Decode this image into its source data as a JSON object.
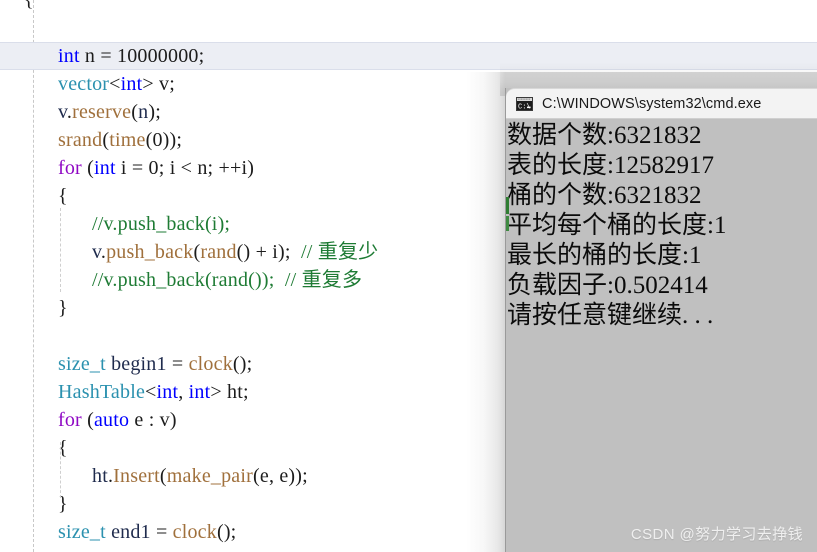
{
  "editor": {
    "name": "code-editor",
    "language": "C++",
    "lines": [
      {
        "indent": 0,
        "tokens": [
          {
            "t": "{",
            "c": "pun"
          }
        ],
        "partial_top": true
      },
      {
        "indent": 0,
        "tokens": [],
        "current": false
      },
      {
        "indent": 1,
        "current": true,
        "tokens": [
          {
            "t": "int",
            "c": "bkw"
          },
          {
            "t": " n = ",
            "c": "pun"
          },
          {
            "t": "10000000",
            "c": "num"
          },
          {
            "t": ";",
            "c": "pun"
          }
        ]
      },
      {
        "indent": 1,
        "tokens": [
          {
            "t": "vector",
            "c": "typ"
          },
          {
            "t": "<",
            "c": "pun"
          },
          {
            "t": "int",
            "c": "bkw"
          },
          {
            "t": "> v;",
            "c": "pun"
          }
        ]
      },
      {
        "indent": 1,
        "tokens": [
          {
            "t": "v",
            "c": "id"
          },
          {
            "t": ".",
            "c": "pun"
          },
          {
            "t": "reserve",
            "c": "fn"
          },
          {
            "t": "(",
            "c": "pun"
          },
          {
            "t": "n",
            "c": "id"
          },
          {
            "t": ");",
            "c": "pun"
          }
        ]
      },
      {
        "indent": 1,
        "tokens": [
          {
            "t": "srand",
            "c": "fn"
          },
          {
            "t": "(",
            "c": "pun"
          },
          {
            "t": "time",
            "c": "fn"
          },
          {
            "t": "(",
            "c": "pun"
          },
          {
            "t": "0",
            "c": "num"
          },
          {
            "t": "));",
            "c": "pun"
          }
        ]
      },
      {
        "indent": 1,
        "tokens": [
          {
            "t": "for",
            "c": "kw"
          },
          {
            "t": " (",
            "c": "pun"
          },
          {
            "t": "int",
            "c": "bkw"
          },
          {
            "t": " i = ",
            "c": "pun"
          },
          {
            "t": "0",
            "c": "num"
          },
          {
            "t": "; i < n; ++i)",
            "c": "pun"
          }
        ]
      },
      {
        "indent": 1,
        "tokens": [
          {
            "t": "{",
            "c": "pun"
          }
        ]
      },
      {
        "indent": 2,
        "tokens": [
          {
            "t": "//v.push_back(i);",
            "c": "cmt"
          }
        ]
      },
      {
        "indent": 2,
        "tokens": [
          {
            "t": "v",
            "c": "id"
          },
          {
            "t": ".",
            "c": "pun"
          },
          {
            "t": "push_back",
            "c": "fn"
          },
          {
            "t": "(",
            "c": "pun"
          },
          {
            "t": "rand",
            "c": "fn"
          },
          {
            "t": "() + i);  ",
            "c": "pun"
          },
          {
            "t": "// 重复少",
            "c": "cmt"
          }
        ]
      },
      {
        "indent": 2,
        "tokens": [
          {
            "t": "//v.push_back(rand());  // 重复多",
            "c": "cmt"
          }
        ]
      },
      {
        "indent": 1,
        "tokens": [
          {
            "t": "}",
            "c": "pun"
          }
        ]
      },
      {
        "indent": 0,
        "tokens": []
      },
      {
        "indent": 1,
        "tokens": [
          {
            "t": "size_t",
            "c": "typ"
          },
          {
            "t": " ",
            "c": "pun"
          },
          {
            "t": "begin1",
            "c": "id"
          },
          {
            "t": " = ",
            "c": "pun"
          },
          {
            "t": "clock",
            "c": "fn"
          },
          {
            "t": "();",
            "c": "pun"
          }
        ]
      },
      {
        "indent": 1,
        "tokens": [
          {
            "t": "HashTable",
            "c": "typ"
          },
          {
            "t": "<",
            "c": "pun"
          },
          {
            "t": "int",
            "c": "bkw"
          },
          {
            "t": ", ",
            "c": "pun"
          },
          {
            "t": "int",
            "c": "bkw"
          },
          {
            "t": "> ht;",
            "c": "pun"
          }
        ]
      },
      {
        "indent": 1,
        "tokens": [
          {
            "t": "for",
            "c": "kw"
          },
          {
            "t": " (",
            "c": "pun"
          },
          {
            "t": "auto",
            "c": "bkw"
          },
          {
            "t": " e : v)",
            "c": "pun"
          }
        ]
      },
      {
        "indent": 1,
        "tokens": [
          {
            "t": "{",
            "c": "pun"
          }
        ]
      },
      {
        "indent": 2,
        "tokens": [
          {
            "t": "ht",
            "c": "id"
          },
          {
            "t": ".",
            "c": "pun"
          },
          {
            "t": "Insert",
            "c": "fn"
          },
          {
            "t": "(",
            "c": "pun"
          },
          {
            "t": "make_pair",
            "c": "fn"
          },
          {
            "t": "(e, e));",
            "c": "pun"
          }
        ]
      },
      {
        "indent": 1,
        "tokens": [
          {
            "t": "}",
            "c": "pun"
          }
        ]
      },
      {
        "indent": 1,
        "tokens": [
          {
            "t": "size_t",
            "c": "typ"
          },
          {
            "t": " ",
            "c": "pun"
          },
          {
            "t": "end1",
            "c": "id"
          },
          {
            "t": " = ",
            "c": "pun"
          },
          {
            "t": "clock",
            "c": "fn"
          },
          {
            "t": "();",
            "c": "pun"
          }
        ]
      }
    ],
    "colors": {
      "keyword": "#8f08c4",
      "type": "#2b91af",
      "builtin_type": "#0000ff",
      "function": "#a0703c",
      "identifier": "#1f2b4d",
      "comment": "#1e7b34",
      "background": "#ffffff",
      "current_line": "#eceef4"
    }
  },
  "console": {
    "title": "C:\\WINDOWS\\system32\\cmd.exe",
    "icon": "cmd-console-icon",
    "background": "#c0c0c0",
    "titlebar_background": "#f3f3f3",
    "lines": [
      "数据个数:6321832",
      "表的长度:12582917",
      "桶的个数:6321832",
      "平均每个桶的长度:1",
      "最长的桶的长度:1",
      "负载因子:0.502414",
      "请按任意键继续. . ."
    ]
  },
  "watermark": {
    "text": "CSDN @努力学习去挣钱"
  }
}
